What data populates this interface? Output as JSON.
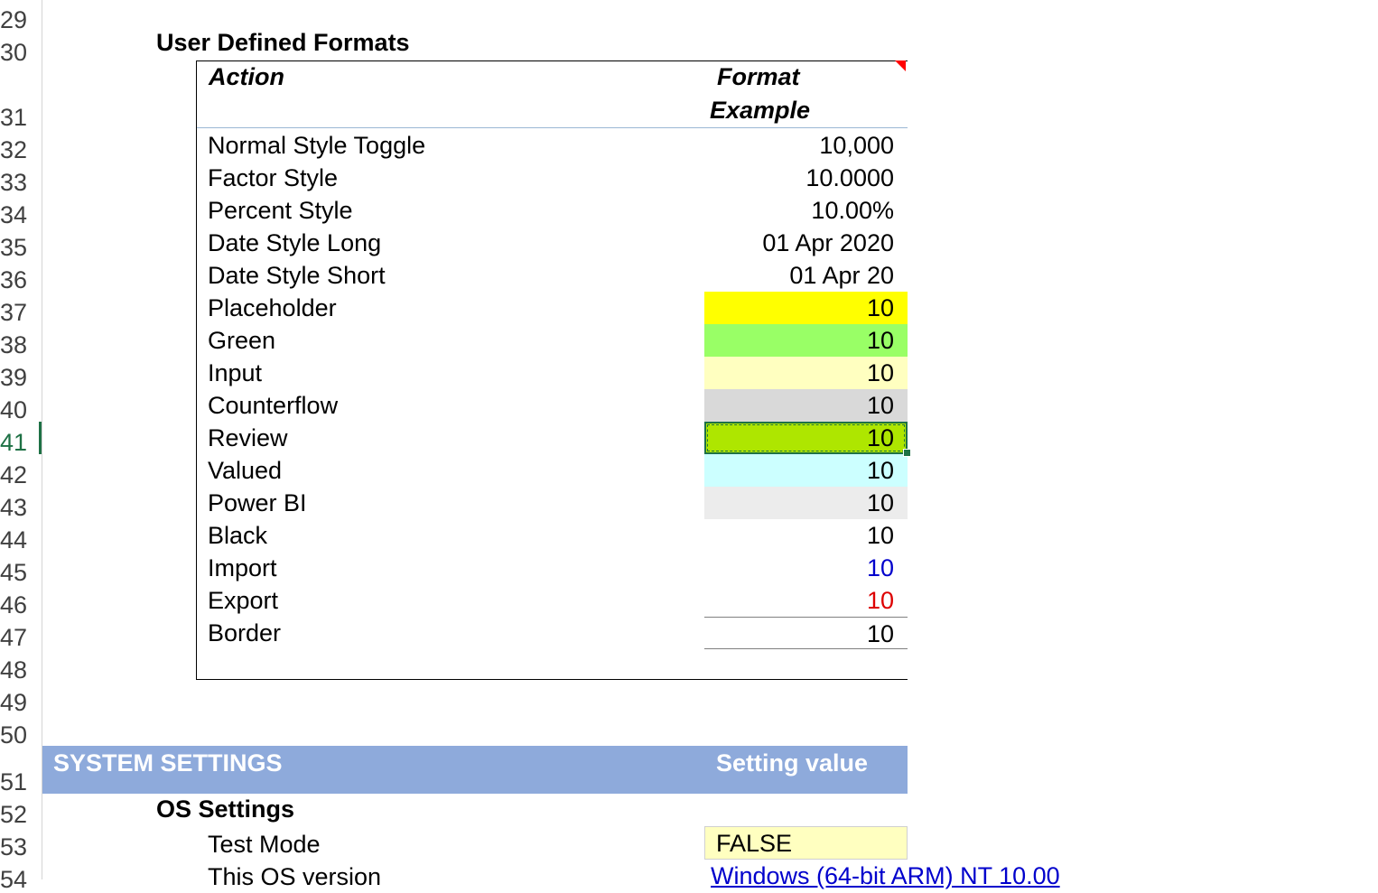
{
  "row_numbers": [
    "29",
    "30",
    "31",
    "32",
    "33",
    "34",
    "35",
    "36",
    "37",
    "38",
    "39",
    "40",
    "41",
    "42",
    "43",
    "44",
    "45",
    "46",
    "47",
    "48",
    "49",
    "50",
    "51",
    "52",
    "53",
    "54"
  ],
  "active_row": "41",
  "user_defined_formats": {
    "title": "User Defined Formats",
    "header_action": "Action",
    "header_format_line1": "Format",
    "header_format_line2": "Example",
    "rows": [
      {
        "label": "Normal Style Toggle",
        "value": "10,000",
        "fill": "#ffffff",
        "color": "#000000"
      },
      {
        "label": "Factor Style",
        "value": "10.0000",
        "fill": "#ffffff",
        "color": "#000000"
      },
      {
        "label": "Percent Style",
        "value": "10.00%",
        "fill": "#ffffff",
        "color": "#000000"
      },
      {
        "label": "Date Style Long",
        "value": "01 Apr 2020",
        "fill": "#ffffff",
        "color": "#000000"
      },
      {
        "label": "Date Style Short",
        "value": "01 Apr 20",
        "fill": "#ffffff",
        "color": "#000000"
      },
      {
        "label": "Placeholder",
        "value": "10",
        "fill": "#ffff00",
        "color": "#000000"
      },
      {
        "label": "Green",
        "value": "10",
        "fill": "#99ff66",
        "color": "#000000"
      },
      {
        "label": "Input",
        "value": "10",
        "fill": "#ffffc0",
        "color": "#000000"
      },
      {
        "label": "Counterflow",
        "value": "10",
        "fill": "#d9d9d9",
        "color": "#000000"
      },
      {
        "label": "Review",
        "value": "10",
        "fill": "#aee600",
        "color": "#000000"
      },
      {
        "label": "Valued",
        "value": "10",
        "fill": "#ccffff",
        "color": "#000000"
      },
      {
        "label": "Power BI",
        "value": "10",
        "fill": "#ececec",
        "color": "#000000"
      },
      {
        "label": "Black",
        "value": "10",
        "fill": "#ffffff",
        "color": "#000000"
      },
      {
        "label": "Import",
        "value": "10",
        "fill": "#ffffff",
        "color": "#0000cc"
      },
      {
        "label": "Export",
        "value": "10",
        "fill": "#ffffff",
        "color": "#dd0000"
      },
      {
        "label": "Border",
        "value": "10",
        "fill": "#ffffff",
        "color": "#000000"
      }
    ]
  },
  "system_settings": {
    "banner_left": "SYSTEM SETTINGS",
    "banner_right": "Setting value",
    "section_title": "OS Settings",
    "test_mode_label": "Test Mode",
    "test_mode_value": "FALSE",
    "os_version_label": "This OS version",
    "os_version_value": "Windows (64-bit ARM) NT 10.00"
  },
  "colors": {
    "banner": "#8eaadb",
    "selection": "#1e7145",
    "comment_flag": "#ff0000"
  }
}
